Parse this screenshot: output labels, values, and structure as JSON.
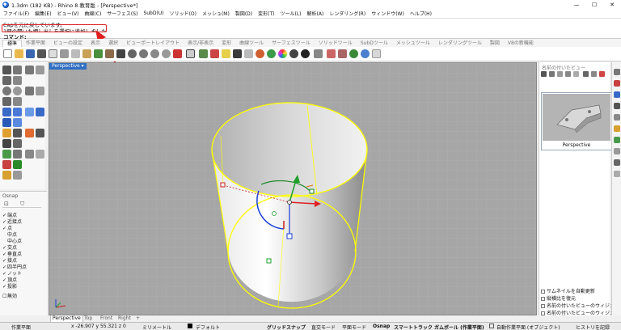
{
  "window": {
    "title": "1.3dm (182 KB) - Rhino 8 教育版 - [Perspective*]",
    "controls": [
      "—",
      "☐",
      "✕"
    ]
  },
  "menu": [
    "ファイル(F)",
    "編集(E)",
    "ビュー(V)",
    "曲線(C)",
    "サーフェス(S)",
    "SubD(U)",
    "ソリッド(O)",
    "メッシュ(M)",
    "製図(D)",
    "変形(T)",
    "ツール(L)",
    "解析(A)",
    "レンダリング(R)",
    "ウィンドウ(W)",
    "ヘルプ(H)"
  ],
  "command": {
    "history": [
      "Capを元に戻しています。",
      "1個の開いた押し出しを選択に追加しました。"
    ],
    "prompt": "コマンド:"
  },
  "toolbar_tabs": [
    "標準",
    "作業平面",
    "ビューの設定",
    "表示",
    "選択",
    "ビューポートレイアウト",
    "表示/非表示",
    "変形",
    "曲線ツール",
    "サーフェスツール",
    "ソリッドツール",
    "SubDツール",
    "メッシュツール",
    "レンダリングツール",
    "製図",
    "V8の新機能"
  ],
  "viewport": {
    "label": "Perspective",
    "tabs": [
      "Perspective",
      "Top",
      "Front",
      "Right",
      "+"
    ]
  },
  "osnap": {
    "title": "Osnap",
    "items": [
      {
        "label": "端点",
        "checked": true
      },
      {
        "label": "近接点",
        "checked": true
      },
      {
        "label": "点",
        "checked": true
      },
      {
        "label": "中点",
        "checked": false
      },
      {
        "label": "中心点",
        "checked": false
      },
      {
        "label": "交点",
        "checked": true
      },
      {
        "label": "垂直点",
        "checked": true
      },
      {
        "label": "接点",
        "checked": true
      },
      {
        "label": "四半円点",
        "checked": true
      },
      {
        "label": "ノット",
        "checked": true
      },
      {
        "label": "頂点",
        "checked": true
      },
      {
        "label": "投影",
        "checked": true
      },
      {
        "label": "無効",
        "checked": false
      }
    ]
  },
  "named_views": {
    "title": "名前の付いたビュー",
    "thumb_label": "Perspective",
    "options": [
      "サムネイルを自動更新",
      "縦横比を復元",
      "名前の付いたビューのウィジェ",
      "名前の付いたビューのウィジェ"
    ]
  },
  "status": {
    "plane": "作業平面",
    "coords": "x -26.907  y 55.321  z 0",
    "units": "ミリメートル",
    "layer": "デフォルト",
    "toggles": [
      "グリッドスナップ",
      "直交モード",
      "平面モード",
      "Osnap",
      "スマートトラック",
      "ガムボール (作業平面)",
      "自動作業平面 (オブジェクト)",
      "ヒストリを記録"
    ]
  },
  "colors": {
    "accent": "#2f6fc4",
    "highlight_box": "#e02020",
    "selection": "#ffff00",
    "viewport_bg": "#a6a6a6"
  }
}
